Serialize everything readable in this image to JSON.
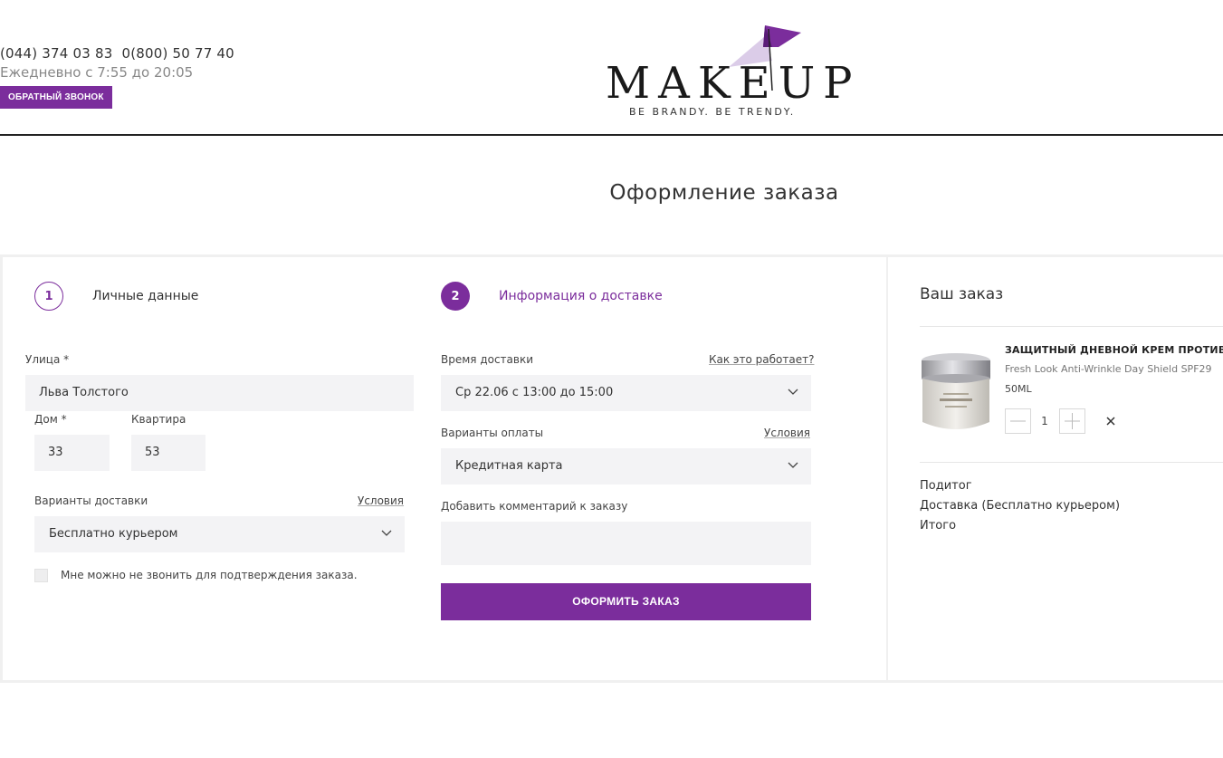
{
  "header": {
    "phone1": "(044) 374 03 83",
    "phone2": "0(800) 50 77 40",
    "hours": "Ежедневно с 7:55 до 20:05",
    "callback_label": "ОБРАТНЫЙ ЗВОНОК",
    "logo_text": "MAKEUP",
    "logo_tagline": "BE BRANDY.  BE TRENDY."
  },
  "page_title": "Оформление заказа",
  "steps": [
    {
      "number": "1",
      "label": "Личные данные",
      "state": "done"
    },
    {
      "number": "2",
      "label": "Информация о доставке",
      "state": "active"
    }
  ],
  "address": {
    "street_label": "Улица *",
    "street_value": "Льва Толстого",
    "house_label": "Дом *",
    "house_value": "33",
    "apartment_label": "Квартира",
    "apartment_value": "53"
  },
  "delivery": {
    "label": "Варианты доставки",
    "terms_link": "Условия",
    "selected": "Бесплатно курьером"
  },
  "no_call": {
    "checked": false,
    "label": "Мне можно не звонить для подтверждения заказа."
  },
  "delivery_time": {
    "label": "Время доставки",
    "help_link": "Как это работает?",
    "selected": "Ср 22.06 с 13:00 до 15:00"
  },
  "payment": {
    "label": "Варианты оплаты",
    "terms_link": "Условия",
    "selected": "Кредитная карта"
  },
  "comment": {
    "label": "Добавить комментарий к заказу",
    "value": ""
  },
  "submit_label": "ОФОРМИТЬ ЗАКАЗ",
  "order": {
    "title": "Ваш заказ",
    "item": {
      "name": "ЗАЩИТНЫЙ ДНЕВНОЙ КРЕМ ПРОТИВ МО",
      "subtitle": "Fresh Look Anti-Wrinkle Day Shield SPF29",
      "volume": "50ML",
      "quantity": "1"
    },
    "subtotal_label": "Подитог",
    "delivery_label": "Доставка (Бесплатно курьером)",
    "total_label": "Итого"
  },
  "colors": {
    "accent": "#7b2d9c",
    "field_bg": "#f3f3f5",
    "text": "#333333"
  }
}
